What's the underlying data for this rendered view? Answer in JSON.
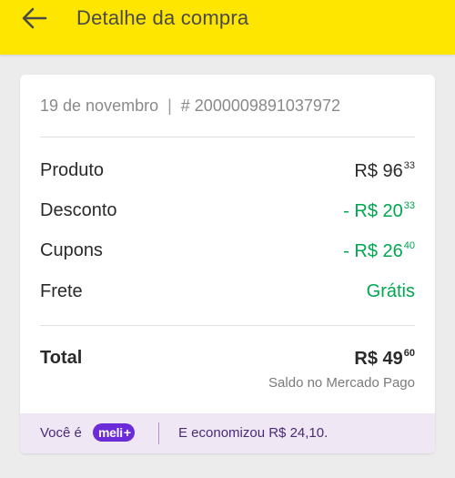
{
  "header": {
    "title": "Detalhe da compra",
    "back_icon": "arrow-left-icon",
    "bg_color": "#ffe600"
  },
  "purchase": {
    "date": "19 de novembro",
    "separator": "|",
    "order_id": "# 2000009891037972"
  },
  "summary": [
    {
      "label": "Produto",
      "value_main": "R$ 96",
      "value_cents": "33",
      "color": "#2a2a2a"
    },
    {
      "label": "Desconto",
      "value_main": "- R$ 20",
      "value_cents": "33",
      "color": "#00a650"
    },
    {
      "label": "Cupons",
      "value_main": "- R$ 26",
      "value_cents": "40",
      "color": "#00a650"
    },
    {
      "label": "Frete",
      "value_main": "Grátis",
      "value_cents": "",
      "color": "#00a650"
    }
  ],
  "total": {
    "label": "Total",
    "value_main": "R$ 49",
    "value_cents": "60",
    "payment_note": "Saldo no Mercado Pago"
  },
  "meli_plus": {
    "prefix": "Você é",
    "badge_text": "meli",
    "badge_plus": "+",
    "saved_text": "E economizou R$ 24,10.",
    "badge_color": "#6c2bd9"
  }
}
